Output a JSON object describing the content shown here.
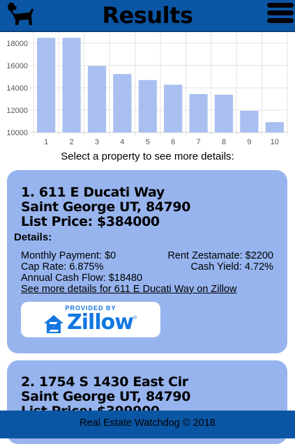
{
  "header": {
    "title": "Results",
    "logo_icon": "dog-icon",
    "menu_icon": "hamburger-menu-icon"
  },
  "chart_data": {
    "type": "bar",
    "categories": [
      "1",
      "2",
      "3",
      "4",
      "5",
      "6",
      "7",
      "8",
      "9",
      "10"
    ],
    "values": [
      18480,
      18480,
      15960,
      15240,
      14700,
      14280,
      13440,
      13380,
      11940,
      10920
    ],
    "ylim": [
      10000,
      19000
    ],
    "yticks": [
      10000,
      12000,
      14000,
      16000,
      18000
    ],
    "bar_color": "#a8bff0",
    "grid": true
  },
  "prompt": "Select a property to see more details:",
  "properties": [
    {
      "title": "1. 611 E Ducati Way",
      "city": "Saint George UT, 84790",
      "price": "List Price: $384000",
      "details_label": "Details:",
      "monthly_payment": "Monthly Payment: $0",
      "rent_zestimate": "Rent Zestamate: $2200",
      "cap_rate": "Cap Rate: 6.875%",
      "cash_yield": "Cash Yield: 4.72%",
      "annual_cash_flow": "Annual Cash Flow: $18480",
      "link": "See more details for 611 E Ducati Way on Zillow"
    },
    {
      "title": "2. 1754 S 1430 East Cir",
      "city": "Saint George UT, 84790",
      "price": "List Price: $399900"
    }
  ],
  "zillow": {
    "provided_by": "PROVIDED BY",
    "wordmark": "Zillow",
    "reg": "®"
  },
  "footer": "Real Estate Watchdog © 2018",
  "colors": {
    "header": "#0b56a4",
    "card": "#97b4ee",
    "bar": "#a8bff0",
    "zillow_blue": "#1277e1"
  }
}
